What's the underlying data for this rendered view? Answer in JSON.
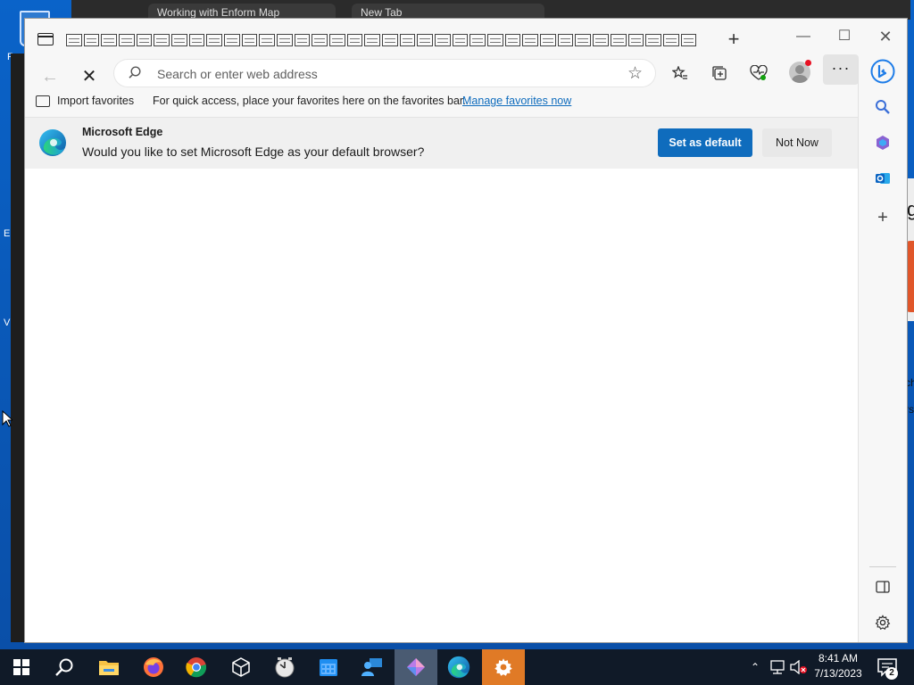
{
  "desktop": {
    "recycle_label": "Rec",
    "edge_labels": [
      "E",
      "V"
    ],
    "bg_tabs": [
      "Working with Enform Map",
      "New Tab"
    ],
    "right_edge_glyphs": [
      "g",
      "ch",
      "rs"
    ]
  },
  "browser": {
    "address_placeholder": "Search or enter web address",
    "favorites_bar": {
      "import_label": "Import favorites",
      "message": "For quick access, place your favorites here on the favorites bar.",
      "link": "Manage favorites now"
    },
    "infobar": {
      "title": "Microsoft Edge",
      "text": "Would you like to set Microsoft Edge as your default browser?",
      "primary_button": "Set as default",
      "secondary_button": "Not Now"
    },
    "accent_color": "#0f6cbd"
  },
  "taskbar": {
    "time": "8:41 AM",
    "date": "7/13/2023",
    "notification_count": "2",
    "pinned": [
      "start-icon",
      "search-icon",
      "file-explorer-icon",
      "firefox-icon",
      "chrome-icon",
      "cube-icon",
      "clock-app-icon",
      "calendar-icon",
      "people-icon",
      "pen-app-icon",
      "edge-icon",
      "settings-icon"
    ]
  }
}
